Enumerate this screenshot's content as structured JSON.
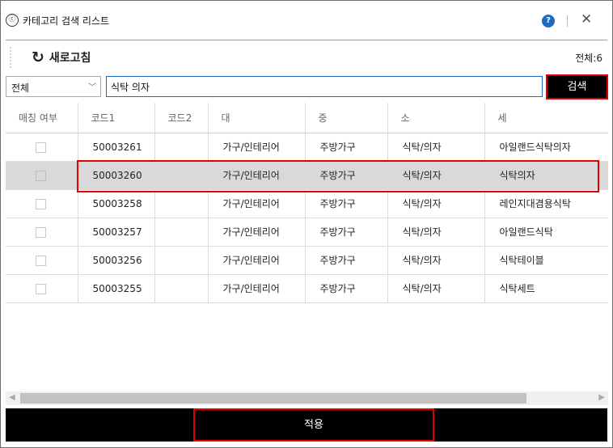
{
  "window": {
    "title": "카테고리 검색 리스트",
    "app_icon": "logo-icon",
    "help_glyph": "?",
    "close_glyph": "✕"
  },
  "toolbar": {
    "refresh_label": "새로고침",
    "total": "전체:6"
  },
  "search": {
    "category_selected": "전체",
    "query": "식탁 의자",
    "button_label": "검색"
  },
  "grid": {
    "columns": [
      "매칭 여부",
      "코드1",
      "코드2",
      "대",
      "중",
      "소",
      "세"
    ],
    "rows": [
      {
        "code1": "50003261",
        "code2": "",
        "large": "가구/인테리어",
        "medium": "주방가구",
        "small": "식탁/의자",
        "detail": "아일랜드식탁의자"
      },
      {
        "code1": "50003260",
        "code2": "",
        "large": "가구/인테리어",
        "medium": "주방가구",
        "small": "식탁/의자",
        "detail": "식탁의자"
      },
      {
        "code1": "50003258",
        "code2": "",
        "large": "가구/인테리어",
        "medium": "주방가구",
        "small": "식탁/의자",
        "detail": "레인지대겸용식탁"
      },
      {
        "code1": "50003257",
        "code2": "",
        "large": "가구/인테리어",
        "medium": "주방가구",
        "small": "식탁/의자",
        "detail": "아일랜드식탁"
      },
      {
        "code1": "50003256",
        "code2": "",
        "large": "가구/인테리어",
        "medium": "주방가구",
        "small": "식탁/의자",
        "detail": "식탁테이블"
      },
      {
        "code1": "50003255",
        "code2": "",
        "large": "가구/인테리어",
        "medium": "주방가구",
        "small": "식탁/의자",
        "detail": "식탁세트"
      }
    ]
  },
  "footer": {
    "apply_label": "적용"
  },
  "colors": {
    "accent": "#1f6bc2",
    "highlight": "#e00000",
    "selected_row": "#d9d9d9",
    "button_bg": "#000000"
  }
}
